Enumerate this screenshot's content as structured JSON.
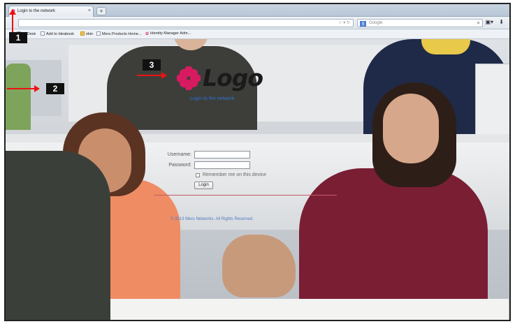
{
  "browser": {
    "tab_title": "Login to the network",
    "new_tab_label": "+",
    "close_tab_label": "×",
    "search_placeholder": "Google",
    "search_engine_letter": "g",
    "bookmarks": [
      {
        "label": "AirDesk",
        "icon": "page-icon"
      },
      {
        "label": "Add to Ideabook",
        "icon": "page-icon"
      },
      {
        "label": "ekin",
        "icon": "folder-icon"
      },
      {
        "label": "Meru Products Home...",
        "icon": "page-icon"
      },
      {
        "label": "Identity Manager Adm...",
        "icon": "flower-icon"
      }
    ]
  },
  "login": {
    "logo_text": "Logo",
    "caption": "Login to the network",
    "username_label": "Username:",
    "password_label": "Password:",
    "remember_label": "Remember me on this device",
    "login_button": "Login",
    "copyright": "© 2013 Meru Networks. All Rights Reserved."
  },
  "annotations": {
    "callout_1": "1",
    "callout_2": "2",
    "callout_3": "3"
  },
  "colors": {
    "accent": "#d81b60",
    "arrow": "#e11111",
    "link": "#2e6fcf"
  }
}
